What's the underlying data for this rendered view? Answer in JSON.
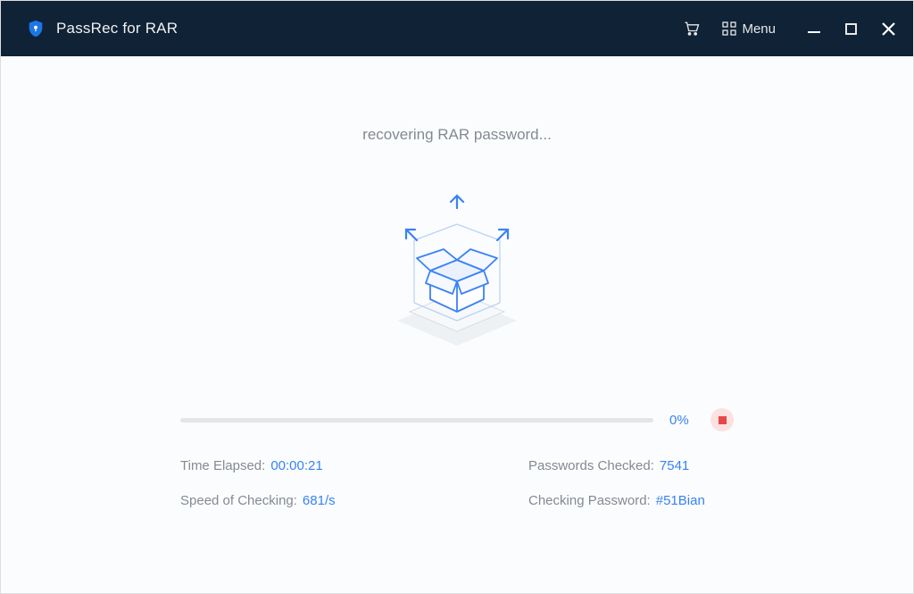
{
  "header": {
    "app_title": "PassRec for RAR",
    "menu_label": "Menu"
  },
  "main": {
    "status_text": "recovering RAR password...",
    "progress_percent": "0%",
    "stats": {
      "time_elapsed_label": "Time Elapsed:",
      "time_elapsed_value": "00:00:21",
      "passwords_checked_label": "Passwords Checked:",
      "passwords_checked_value": "7541",
      "speed_label": "Speed of Checking:",
      "speed_value": "681/s",
      "checking_password_label": "Checking Password:",
      "checking_password_value": "#51Bian"
    }
  },
  "colors": {
    "titlebar_bg": "#0f2236",
    "accent": "#3a82f6",
    "text_muted": "#848a93",
    "stop_bg": "#fce1e1",
    "stop_fg": "#e54848"
  }
}
